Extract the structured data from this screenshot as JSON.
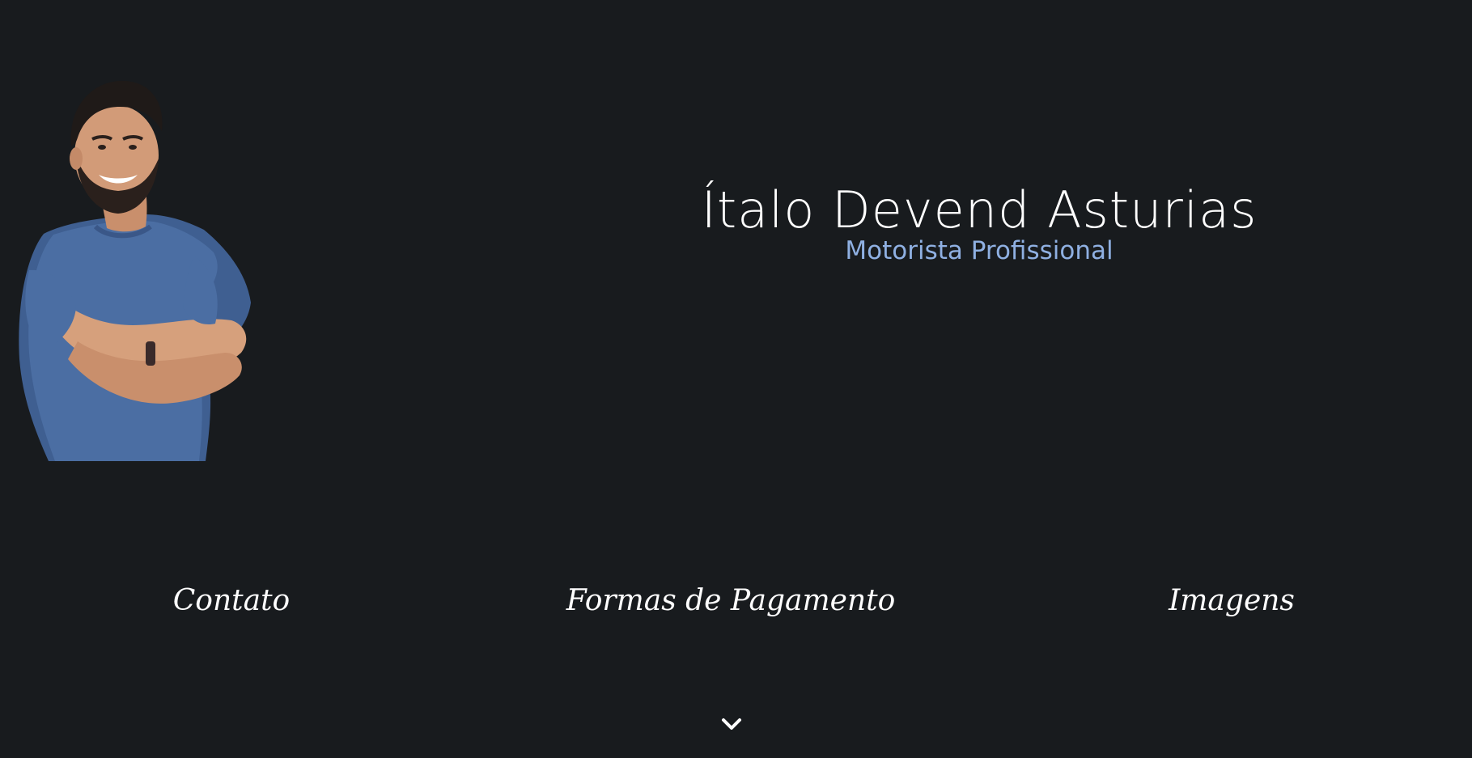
{
  "hero": {
    "name": "Ítalo Devend Asturias",
    "role": "Motorista Profissional"
  },
  "nav": {
    "items": [
      {
        "label": "Contato"
      },
      {
        "label": "Formas de Pagamento"
      },
      {
        "label": "Imagens"
      }
    ]
  },
  "portrait": {
    "icon": "person-portrait"
  },
  "scroll": {
    "icon": "chevron-down-icon"
  },
  "colors": {
    "background": "#181b1e",
    "name": "#ffffff",
    "role": "#8fb0e2",
    "shirt": "#4b6ea3"
  }
}
